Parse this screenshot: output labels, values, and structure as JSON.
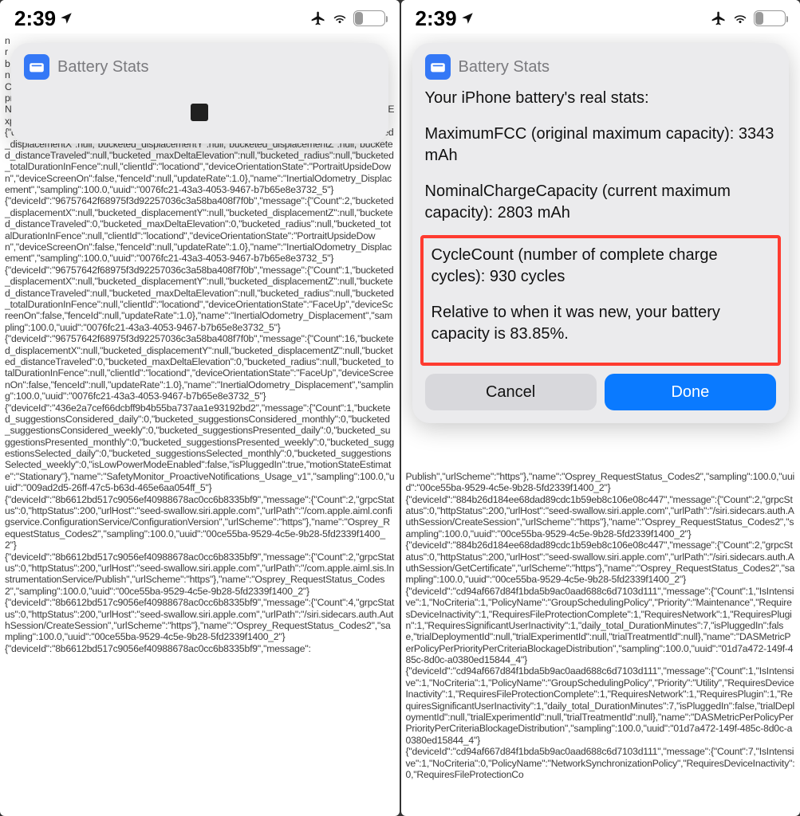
{
  "phones": {
    "left": {
      "status": {
        "time": "2:39",
        "battery_pct": "30",
        "battery_fill_pct": 30
      },
      "popup": {
        "title": "Battery Stats",
        "loading": true
      },
      "backdropText": "n\nr\nb\nn\nCarr\nproductSku\":\"HN/A\",\"rolloverReason\":\"scheduled\",\"servingCarrierName\":\"Vodafone India IN\",\"startTimestamp\":\"2024-01-05T00:15:00Z\",\"stateDbType\":\"sqlite\",\"stateDbVersion\":3,\"trialExperiments\":\"2\",\"trialRollouts\":\"2\",\"version\":\"2.4\"}\n{\"deviceId\":\"96757642f68975f3d92257036c3a58ba408f7f0b\",\"message\":{\"Count\":1,\"bucketed_displacementX\":null,\"bucketed_displacementY\":null,\"bucketed_displacementZ\":null,\"bucketed_distanceTraveled\":null,\"bucketed_maxDeltaElevation\":null,\"bucketed_radius\":null,\"bucketed_totalDurationInFence\":null,\"clientId\":\"locationd\",\"deviceOrientationState\":\"PortraitUpsideDown\",\"deviceScreenOn\":false,\"fenceId\":null,\"updateRate\":1.0},\"name\":\"InertialOdometry_Displacement\",\"sampling\":100.0,\"uuid\":\"0076fc21-43a3-4053-9467-b7b65e8e3732_5\"}\n{\"deviceId\":\"96757642f68975f3d92257036c3a58ba408f7f0b\",\"message\":{\"Count\":2,\"bucketed_displacementX\":null,\"bucketed_displacementY\":null,\"bucketed_displacementZ\":null,\"bucketed_distanceTraveled\":0,\"bucketed_maxDeltaElevation\":0,\"bucketed_radius\":null,\"bucketed_totalDurationInFence\":null,\"clientId\":\"locationd\",\"deviceOrientationState\":\"PortraitUpsideDown\",\"deviceScreenOn\":false,\"fenceId\":null,\"updateRate\":1.0},\"name\":\"InertialOdometry_Displacement\",\"sampling\":100.0,\"uuid\":\"0076fc21-43a3-4053-9467-b7b65e8e3732_5\"}\n{\"deviceId\":\"96757642f68975f3d92257036c3a58ba408f7f0b\",\"message\":{\"Count\":1,\"bucketed_displacementX\":null,\"bucketed_displacementY\":null,\"bucketed_displacementZ\":null,\"bucketed_distanceTraveled\":null,\"bucketed_maxDeltaElevation\":null,\"bucketed_radius\":null,\"bucketed_totalDurationInFence\":null,\"clientId\":\"locationd\",\"deviceOrientationState\":\"FaceUp\",\"deviceScreenOn\":false,\"fenceId\":null,\"updateRate\":1.0},\"name\":\"InertialOdometry_Displacement\",\"sampling\":100.0,\"uuid\":\"0076fc21-43a3-4053-9467-b7b65e8e3732_5\"}\n{\"deviceId\":\"96757642f68975f3d92257036c3a58ba408f7f0b\",\"message\":{\"Count\":16,\"bucketed_displacementX\":null,\"bucketed_displacementY\":null,\"bucketed_displacementZ\":null,\"bucketed_distanceTraveled\":0,\"bucketed_maxDeltaElevation\":0,\"bucketed_radius\":null,\"bucketed_totalDurationInFence\":null,\"clientId\":\"locationd\",\"deviceOrientationState\":\"FaceUp\",\"deviceScreenOn\":false,\"fenceId\":null,\"updateRate\":1.0},\"name\":\"InertialOdometry_Displacement\",\"sampling\":100.0,\"uuid\":\"0076fc21-43a3-4053-9467-b7b65e8e3732_5\"}\n{\"deviceId\":\"436e2a7cef66dcbff9b4b55ba737aa1e93192bd2\",\"message\":{\"Count\":1,\"bucketed_suggestionsConsidered_daily\":0,\"bucketed_suggestionsConsidered_monthly\":0,\"bucketed_suggestionsConsidered_weekly\":0,\"bucketed_suggestionsPresented_daily\":0,\"bucketed_suggestionsPresented_monthly\":0,\"bucketed_suggestionsPresented_weekly\":0,\"bucketed_suggestionsSelected_daily\":0,\"bucketed_suggestionsSelected_monthly\":0,\"bucketed_suggestionsSelected_weekly\":0,\"isLowPowerModeEnabled\":false,\"isPluggedIn\":true,\"motionStateEstimate\":\"Stationary\"},\"name\":\"SafetyMonitor_ProactiveNotifications_Usage_v1\",\"sampling\":100.0,\"uuid\":\"009ad2d5-26ff-47c5-b63d-465e6aa054ff_5\"}\n{\"deviceId\":\"8b6612bd517c9056ef40988678ac0cc6b8335bf9\",\"message\":{\"Count\":2,\"grpcStatus\":0,\"httpStatus\":200,\"urlHost\":\"seed-swallow.siri.apple.com\",\"urlPath\":\"/com.apple.aiml.configservice.ConfigurationService/ConfigurationVersion\",\"urlScheme\":\"https\"},\"name\":\"Osprey_RequestStatus_Codes2\",\"sampling\":100.0,\"uuid\":\"00ce55ba-9529-4c5e-9b28-5fd2339f1400_2\"}\n{\"deviceId\":\"8b6612bd517c9056ef40988678ac0cc6b8335bf9\",\"message\":{\"Count\":2,\"grpcStatus\":0,\"httpStatus\":200,\"urlHost\":\"seed-swallow.siri.apple.com\",\"urlPath\":\"/com.apple.aiml.sis.InstrumentationService/Publish\",\"urlScheme\":\"https\"},\"name\":\"Osprey_RequestStatus_Codes2\",\"sampling\":100.0,\"uuid\":\"00ce55ba-9529-4c5e-9b28-5fd2339f1400_2\"}\n{\"deviceId\":\"8b6612bd517c9056ef40988678ac0cc6b8335bf9\",\"message\":{\"Count\":4,\"grpcStatus\":0,\"httpStatus\":200,\"urlHost\":\"seed-swallow.siri.apple.com\",\"urlPath\":\"/siri.sidecars.auth.AuthSession/CreateSession\",\"urlScheme\":\"https\"},\"name\":\"Osprey_RequestStatus_Codes2\",\"sampling\":100.0,\"uuid\":\"00ce55ba-9529-4c5e-9b28-5fd2339f1400_2\"}\n{\"deviceId\":\"8b6612bd517c9056ef40988678ac0cc6b8335bf9\",\"message\":"
    },
    "right": {
      "status": {
        "time": "2:39",
        "battery_pct": "29",
        "battery_fill_pct": 29
      },
      "popup": {
        "title": "Battery Stats",
        "intro": "Your iPhone battery's real stats:",
        "maxfcc": "MaximumFCC (original maximum capacity): 3343 mAh",
        "nominal": "NominalChargeCapacity (current maximum capacity): 2803 mAh",
        "cycle": "CycleCount (number of complete charge cycles): 930 cycles",
        "relative": "Relative to when it was new, your battery capacity is 83.85%.",
        "cancel": "Cancel",
        "done": "Done"
      },
      "backdropText": "\n\n\n\n\n\n\n\n\n\n\n\n\n\n\n\n\n\n\n\n\n\n\n\n\n\n\n\n\n\n\n\n\n\n\n\n\n\nPublish\",\"urlScheme\":\"https\"},\"name\":\"Osprey_RequestStatus_Codes2\",\"sampling\":100.0,\"uuid\":\"00ce55ba-9529-4c5e-9b28-5fd2339f1400_2\"}\n{\"deviceId\":\"884b26d184ee68dad89cdc1b59eb8c106e08c447\",\"message\":{\"Count\":2,\"grpcStatus\":0,\"httpStatus\":200,\"urlHost\":\"seed-swallow.siri.apple.com\",\"urlPath\":\"/siri.sidecars.auth.AuthSession/CreateSession\",\"urlScheme\":\"https\"},\"name\":\"Osprey_RequestStatus_Codes2\",\"sampling\":100.0,\"uuid\":\"00ce55ba-9529-4c5e-9b28-5fd2339f1400_2\"}\n{\"deviceId\":\"884b26d184ee68dad89cdc1b59eb8c106e08c447\",\"message\":{\"Count\":2,\"grpcStatus\":0,\"httpStatus\":200,\"urlHost\":\"seed-swallow.siri.apple.com\",\"urlPath\":\"/siri.sidecars.auth.AuthSession/GetCertificate\",\"urlScheme\":\"https\"},\"name\":\"Osprey_RequestStatus_Codes2\",\"sampling\":100.0,\"uuid\":\"00ce55ba-9529-4c5e-9b28-5fd2339f1400_2\"}\n{\"deviceId\":\"cd94af667d84f1bda5b9ac0aad688c6d7103d111\",\"message\":{\"Count\":1,\"IsIntensive\":1,\"NoCriteria\":1,\"PolicyName\":\"GroupSchedulingPolicy\",\"Priority\":\"Maintenance\",\"RequiresDeviceInactivity\":1,\"RequiresFileProtectionComplete\":1,\"RequiresNetwork\":1,\"RequiresPlugin\":1,\"RequiresSignificantUserInactivity\":1,\"daily_total_DurationMinutes\":7,\"isPluggedIn\":false,\"trialDeploymentId\":null,\"trialExperimentId\":null,\"trialTreatmentId\":null},\"name\":\"DASMetricPerPolicyPerPriorityPerCriteriaBlockageDistribution\",\"sampling\":100.0,\"uuid\":\"01d7a472-149f-485c-8d0c-a0380ed15844_4\"}\n{\"deviceId\":\"cd94af667d84f1bda5b9ac0aad688c6d7103d111\",\"message\":{\"Count\":1,\"IsIntensive\":1,\"NoCriteria\":1,\"PolicyName\":\"GroupSchedulingPolicy\",\"Priority\":\"Utility\",\"RequiresDeviceInactivity\":1,\"RequiresFileProtectionComplete\":1,\"RequiresNetwork\":1,\"RequiresPlugin\":1,\"RequiresSignificantUserInactivity\":1,\"daily_total_DurationMinutes\":7,\"isPluggedIn\":false,\"trialDeploymentId\":null,\"trialExperimentId\":null,\"trialTreatmentId\":null},\"name\":\"DASMetricPerPolicyPerPriorityPerCriteriaBlockageDistribution\",\"sampling\":100.0,\"uuid\":\"01d7a472-149f-485c-8d0c-a0380ed15844_4\"}\n{\"deviceId\":\"cd94af667d84f1bda5b9ac0aad688c6d7103d111\",\"message\":{\"Count\":7,\"IsIntensive\":1,\"NoCriteria\":0,\"PolicyName\":\"NetworkSynchronizationPolicy\",\"RequiresDeviceInactivity\":0,\"RequiresFileProtectionCo"
    }
  }
}
